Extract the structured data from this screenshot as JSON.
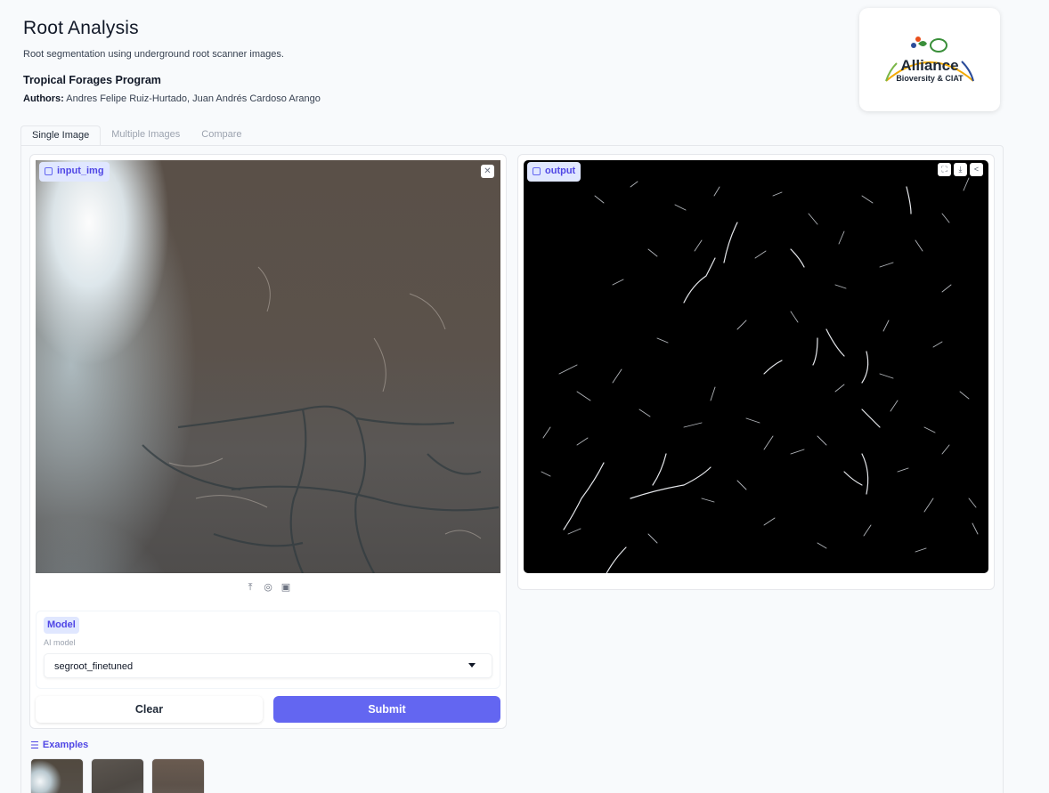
{
  "header": {
    "title": "Root Analysis",
    "subtitle": "Root segmentation using underground root scanner images.",
    "program": "Tropical Forages Program",
    "authors_label": "Authors:",
    "authors": "Andres Felipe Ruiz-Hurtado, Juan Andrés Cardoso Arango"
  },
  "logo": {
    "line1": "Alliance",
    "line2": "Bioversity & CIAT"
  },
  "tabs": [
    {
      "label": "Single Image",
      "active": true
    },
    {
      "label": "Multiple Images",
      "active": false
    },
    {
      "label": "Compare",
      "active": false
    }
  ],
  "input": {
    "label": "input_img",
    "close_icon": "close-icon",
    "toolbar_icons": [
      "upload-icon",
      "webcam-icon",
      "clipboard-icon"
    ]
  },
  "model": {
    "label": "Model",
    "info": "AI model",
    "selected": "segroot_finetuned"
  },
  "buttons": {
    "clear": "Clear",
    "submit": "Submit"
  },
  "output": {
    "label": "output",
    "tools": [
      "fullscreen-icon",
      "download-icon",
      "share-icon"
    ]
  },
  "examples": {
    "label": "Examples",
    "count": 3
  },
  "colors": {
    "accent": "#6366f1",
    "chip_bg": "#e0e7ff",
    "chip_text": "#4f46e5"
  }
}
